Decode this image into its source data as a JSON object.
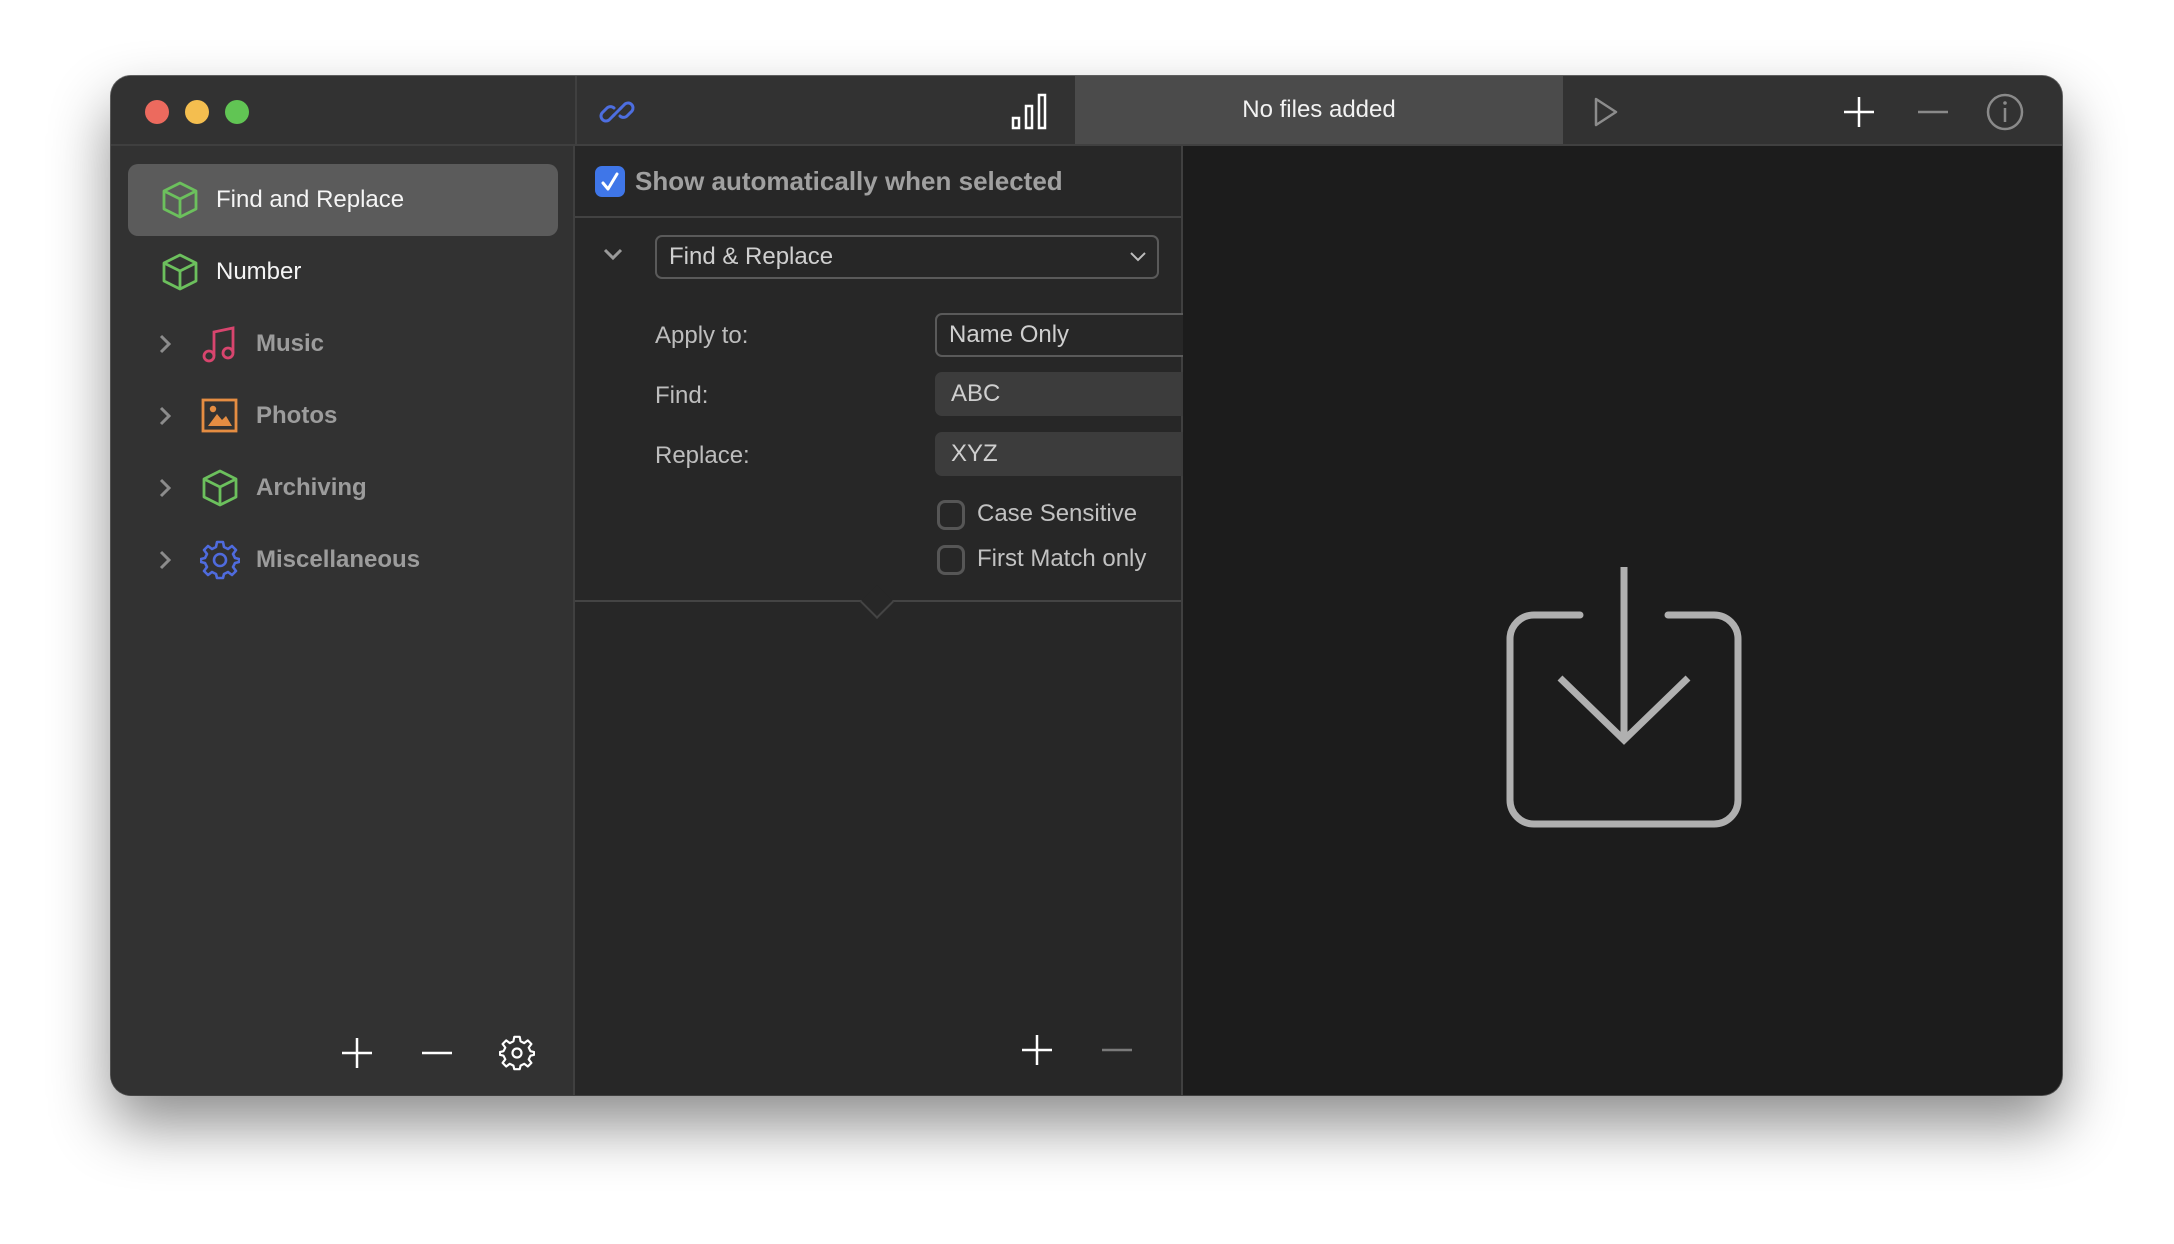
{
  "window": {
    "traffic_lights": [
      "close",
      "minimize",
      "maximize"
    ]
  },
  "toolbar": {
    "link_icon": "link-icon",
    "stats_icon": "bar-chart-icon",
    "status_text": "No files added",
    "play_icon": "play-icon",
    "add_icon": "plus-icon",
    "remove_icon": "minus-icon",
    "info_icon": "info-icon"
  },
  "sidebar": {
    "items": [
      {
        "label": "Find and Replace",
        "icon": "cube-icon",
        "selected": true,
        "expandable": false
      },
      {
        "label": "Number",
        "icon": "cube-icon",
        "selected": false,
        "expandable": false
      },
      {
        "label": "Music",
        "icon": "music-note-icon",
        "selected": false,
        "expandable": true
      },
      {
        "label": "Photos",
        "icon": "photo-icon",
        "selected": false,
        "expandable": true
      },
      {
        "label": "Archiving",
        "icon": "cube-icon",
        "selected": false,
        "expandable": true
      },
      {
        "label": "Miscellaneous",
        "icon": "gear-icon",
        "selected": false,
        "expandable": true
      }
    ],
    "bottom_buttons": [
      "plus-icon",
      "minus-icon",
      "gear-icon"
    ]
  },
  "colors": {
    "accent": "#3f76e8",
    "cube_green": "#6cc05d",
    "music_pink": "#d8456e",
    "photo_orange": "#e58d42",
    "misc_blue": "#4f6bde"
  },
  "action_panel": {
    "show_auto_checked": true,
    "show_auto_label": "Show automatically when selected",
    "action_type": "Find & Replace",
    "apply_to_label": "Apply to:",
    "apply_to_value": "Name Only",
    "find_label": "Find:",
    "find_value": "ABC",
    "replace_label": "Replace:",
    "replace_value": "XYZ",
    "case_sensitive_label": "Case Sensitive",
    "case_sensitive_checked": false,
    "first_match_label": "First Match only",
    "first_match_checked": false
  },
  "dropzone": {
    "icon": "download-tray-icon"
  }
}
